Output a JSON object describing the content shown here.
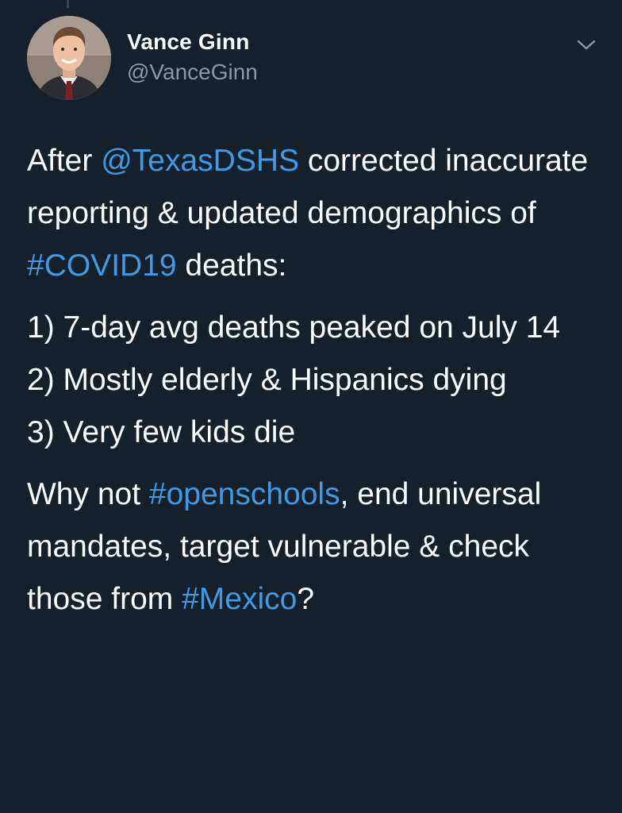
{
  "author": {
    "display_name": "Vance Ginn",
    "handle": "@VanceGinn"
  },
  "icons": {
    "avatar": "user-photo",
    "menu": "chevron-down-icon"
  },
  "colors": {
    "background": "#15202b",
    "link": "#3f9ae6",
    "secondary_text": "#8899a6",
    "text": "#ffffff"
  },
  "tweet": {
    "paragraph1": {
      "seg1": "After ",
      "mention": "@TexasDSHS",
      "seg2": " corrected inaccurate reporting & updated demographics of ",
      "hashtag": "#COVID19",
      "seg3": " deaths:"
    },
    "list": [
      "1) 7-day avg deaths peaked on July 14",
      "2) Mostly elderly & Hispanics dying",
      "3) Very few kids die"
    ],
    "paragraph3": {
      "seg1": "Why not ",
      "hashtag1": "#openschools",
      "seg2": ", end universal mandates, target vulnerable & check those from ",
      "hashtag2": "#Mexico",
      "seg3": "?"
    }
  }
}
